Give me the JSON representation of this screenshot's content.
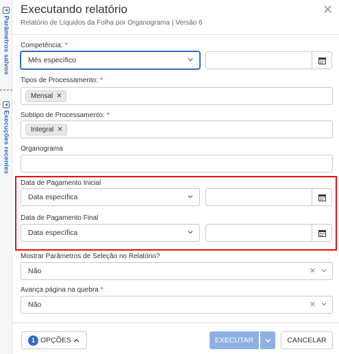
{
  "rail": {
    "saved_params": "Parâmetros salvos",
    "recent_runs": "Execuções recentes"
  },
  "header": {
    "title": "Executando relatório",
    "subtitle": "Relatório de Líquidos da Folha por Organograma | Versão 6",
    "close_glyph": "✕"
  },
  "form": {
    "competencia": {
      "label": "Competência:",
      "required": "*",
      "value": "Mês específico",
      "date_value": ""
    },
    "tipos_processamento": {
      "label": "Tipos de Processamento:",
      "required": "*",
      "chip": "Mensal"
    },
    "subtipo_processamento": {
      "label": "Subtipo de Processamento:",
      "required": "*",
      "chip": "Integral"
    },
    "organograma": {
      "label": "Organograma",
      "value": ""
    },
    "data_pagamento_inicial": {
      "label": "Data de Pagamento Inicial",
      "value": "Data específica",
      "date_value": ""
    },
    "data_pagamento_final": {
      "label": "Data de Pagamento Final",
      "value": "Data específica",
      "date_value": ""
    },
    "mostrar_parametros": {
      "label": "Mostrar Parâmetros de Seleção no Relatório?",
      "value": "Não"
    },
    "avanca_pagina": {
      "label": "Avança página na quebra",
      "required": "*",
      "value": "Não"
    }
  },
  "footer": {
    "options_count": "1",
    "options_label": "OPÇÕES",
    "execute_label": "EXECUTAR",
    "cancel_label": "CANCELAR"
  },
  "colors": {
    "accent": "#2d6cbf",
    "required": "#d9262c",
    "highlight": "#e01010",
    "execute_disabled": "#8fb1e2"
  },
  "icons": [
    "calendar-icon",
    "chevron-down-icon",
    "close-icon",
    "chevron-up-icon",
    "clear-icon"
  ]
}
